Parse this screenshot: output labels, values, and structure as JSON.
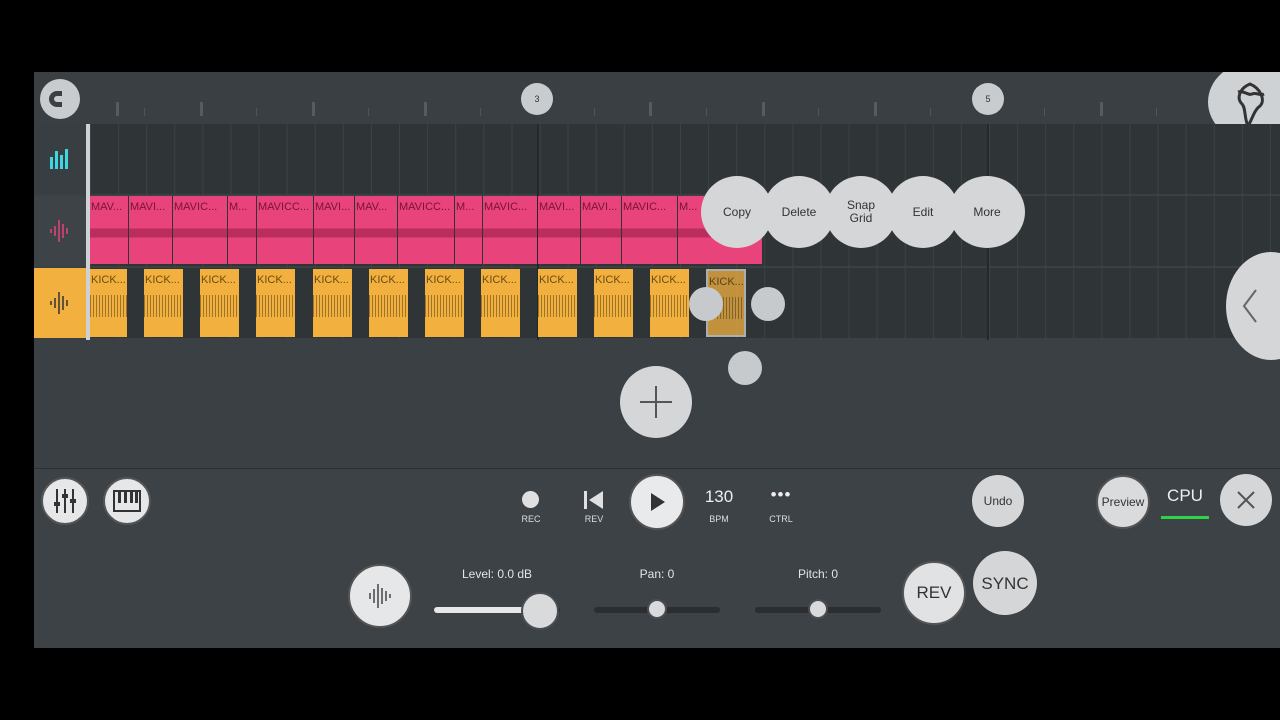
{
  "timeline": {
    "markers": [
      "3",
      "5"
    ]
  },
  "tracks": {
    "pink_clips": [
      "MAV...",
      "MAVI...",
      "MAVIC...",
      "M...",
      "MAVICC...",
      "MAVI...",
      "MAV...",
      "MAVICC...",
      "M...",
      "MAVIC...",
      "MAVI...",
      "MAVI...",
      "MAVIC...",
      "M..."
    ],
    "gold_clips": [
      "KICK...",
      "KICK...",
      "KICK...",
      "KICK...",
      "KICK...",
      "KICK...",
      "KICK...",
      "KICK...",
      "KICK...",
      "KICK...",
      "KICK...",
      "KICK..."
    ],
    "selected_clip": "KICK..."
  },
  "context_menu": {
    "copy": "Copy",
    "delete": "Delete",
    "snap": "Snap\nGrid",
    "edit": "Edit",
    "more": "More"
  },
  "transport": {
    "rec_label": "REC",
    "rev_label": "REV",
    "bpm_value": "130",
    "bpm_label": "BPM",
    "ctrl_label": "CTRL",
    "ctrl_dots": "•••",
    "undo": "Undo",
    "preview": "Preview",
    "cpu": "CPU"
  },
  "sample_controls": {
    "level_label": "Level: 0.0 dB",
    "pan_label": "Pan: 0",
    "pitch_label": "Pitch: 0",
    "rev_button": "REV",
    "sync_button": "SYNC"
  },
  "colors": {
    "pink": "#e8437b",
    "gold": "#f2b13f",
    "cyan": "#3fd6e0",
    "cpu_bar": "#2fd34a"
  }
}
